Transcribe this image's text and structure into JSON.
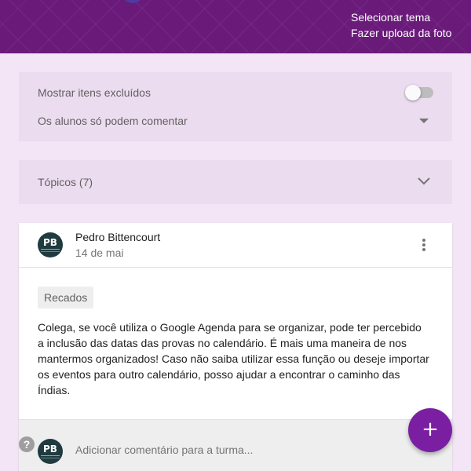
{
  "header": {
    "select_theme": "Selecionar tema",
    "upload_photo": "Fazer upload da foto"
  },
  "settings": {
    "show_deleted_label": "Mostrar itens excluídos",
    "show_deleted_enabled": false,
    "comment_permission": "Os alunos só podem comentar"
  },
  "topics": {
    "label": "Tópicos (7)"
  },
  "post": {
    "avatar_initials": "PB",
    "author": "Pedro Bittencourt",
    "date": "14 de mai",
    "topic_chip": "Recados",
    "body": "Colega, se você utiliza o Google Agenda para se organizar, pode ter percebido a inclusão das datas das provas no calendário. É mais uma maneira de nos mantermos organizados! Caso não saiba utilizar essa função ou deseje importar os eventos para outro calendário, posso ajudar a encontrar o caminho das Índias."
  },
  "comment": {
    "avatar_initials": "PB",
    "placeholder": "Adicionar comentário para a turma..."
  },
  "help": {
    "glyph": "?"
  },
  "fab": {
    "glyph": "+"
  },
  "icons": {
    "toggle": "toggle-switch",
    "dropdown": "dropdown-arrow-icon",
    "chevron": "chevron-down-icon",
    "more": "more-vert-icon",
    "help": "help-icon",
    "add": "add-icon"
  },
  "colors": {
    "header_bg": "#6a1b7a",
    "page_bg": "#f3e5f5",
    "card_bg": "#ecdcef",
    "fab": "#7b1fa2"
  }
}
